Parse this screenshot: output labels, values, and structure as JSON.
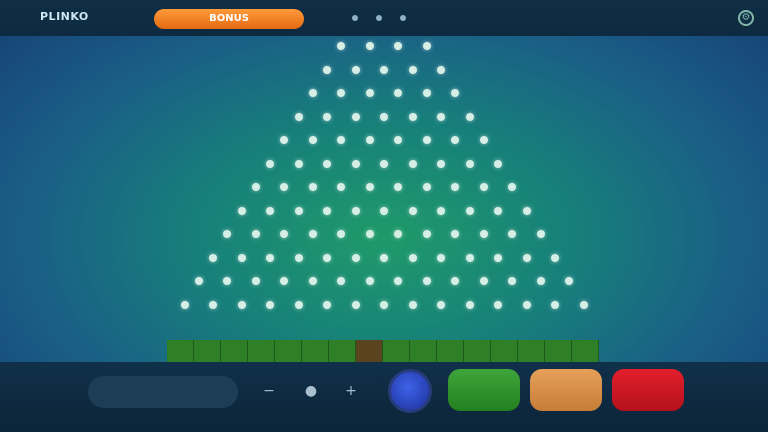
{
  "header": {
    "logo_text": "PLINKO",
    "promo_text": "BONUS",
    "balance_text": "",
    "settings_icon": "gear-icon"
  },
  "board": {
    "rows": 12,
    "first_row_pegs": 4,
    "peg_color": "#d6efe6",
    "slot_count": 16,
    "slot_labels": [
      "",
      "",
      "",
      "",
      "",
      "",
      "",
      "",
      "",
      "",
      "",
      "",
      "",
      "",
      "",
      ""
    ]
  },
  "controls": {
    "stake_label": "",
    "stake_value": "",
    "minus_icon": "minus-icon",
    "plus_icon": "plus-icon",
    "dec_symbol": "−",
    "inc_symbol": "+",
    "chip_icon": "coin-icon"
  },
  "buttons": {
    "green_label": "",
    "orange_label": "",
    "red_label": ""
  },
  "colors": {
    "green_button": "#2f8f2a",
    "orange_button": "#d48a45",
    "red_button": "#c8161f",
    "blue_chip": "#2b48c8"
  }
}
